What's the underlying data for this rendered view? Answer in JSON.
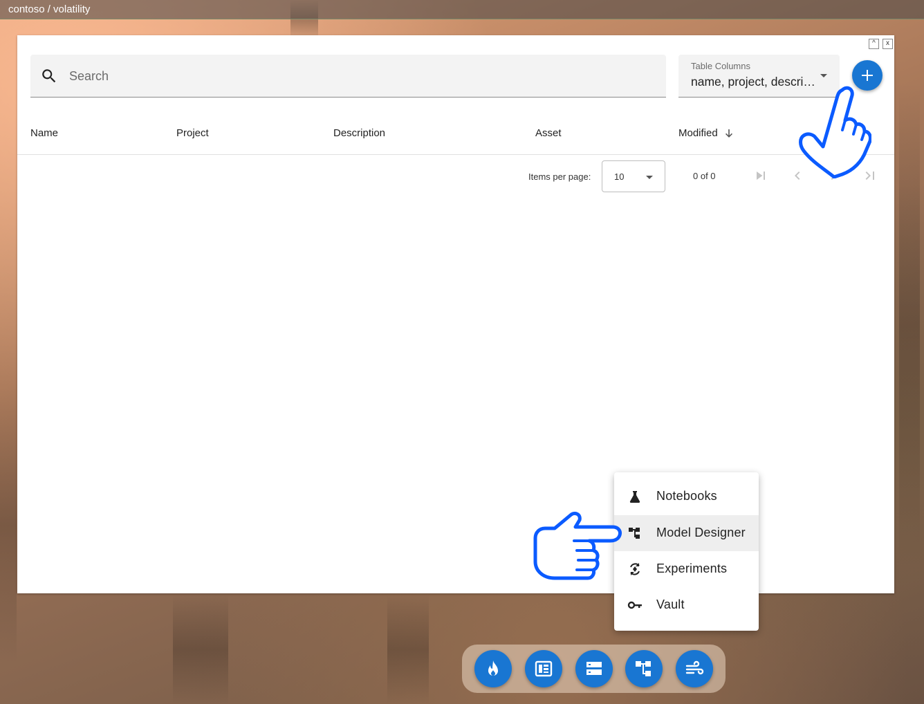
{
  "topbar": {
    "breadcrumb": "contoso / volatility"
  },
  "search": {
    "placeholder": "Search",
    "value": ""
  },
  "columns_select": {
    "label": "Table Columns",
    "value": "name, project, descri…"
  },
  "table": {
    "headers": [
      "Name",
      "Project",
      "Description",
      "Asset",
      "Modified"
    ],
    "sort_column": "Modified",
    "sort_direction": "descending",
    "rows": []
  },
  "paginator": {
    "items_per_page_label": "Items per page:",
    "items_per_page": "10",
    "range_label": "0 of 0"
  },
  "menu": {
    "items": [
      {
        "label": "Notebooks",
        "icon": "flask-icon"
      },
      {
        "label": "Model Designer",
        "icon": "schema-icon",
        "active": true
      },
      {
        "label": "Experiments",
        "icon": "experiment-cycle-icon"
      },
      {
        "label": "Vault",
        "icon": "key-icon"
      }
    ]
  },
  "dock": {
    "buttons": [
      {
        "icon": "flame-icon"
      },
      {
        "icon": "dashboard-icon"
      },
      {
        "icon": "storage-icon"
      },
      {
        "icon": "schema-icon"
      },
      {
        "icon": "wind-icon"
      }
    ]
  },
  "colors": {
    "accent": "#1976d2",
    "hand_outline": "#0b5bff"
  }
}
